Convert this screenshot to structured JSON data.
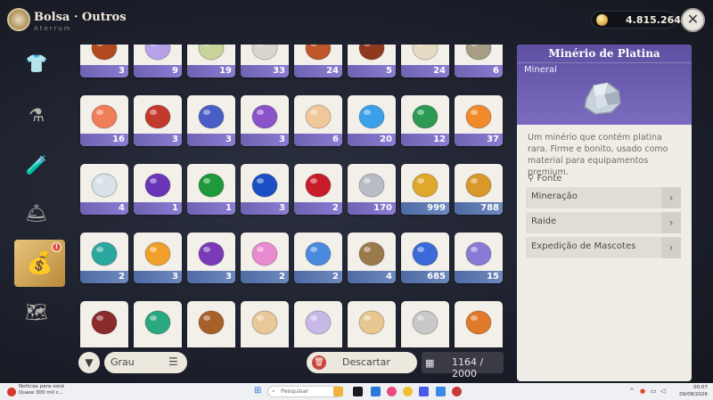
{
  "header": {
    "title": "Bolsa · Outros",
    "subtitle": "Aterrum",
    "currency_value": "4.815.264",
    "close_label": "✕"
  },
  "sidebar": {
    "items": [
      {
        "name": "sidebar-item-clothing",
        "icon": "shirt-icon",
        "glyph": "👕"
      },
      {
        "name": "sidebar-item-crafting",
        "icon": "flask-icon",
        "glyph": "⚗"
      },
      {
        "name": "sidebar-item-potion",
        "icon": "potion-icon",
        "glyph": "🧪"
      },
      {
        "name": "sidebar-item-food",
        "icon": "cloche-icon",
        "glyph": "🛎"
      },
      {
        "name": "sidebar-item-others",
        "icon": "bag-icon",
        "glyph": "💰",
        "badge": "!"
      },
      {
        "name": "sidebar-item-map",
        "icon": "map-icon",
        "glyph": "🗺"
      }
    ]
  },
  "inventory": {
    "rows": [
      [
        {
          "name": "beetle",
          "qty": "3",
          "color": "#b34a1f"
        },
        {
          "name": "pearl",
          "qty": "9",
          "color": "#b7a1e8"
        },
        {
          "name": "leaf",
          "qty": "19",
          "color": "#c8d49a"
        },
        {
          "name": "feather",
          "qty": "33",
          "color": "#d9d5cf"
        },
        {
          "name": "fur-ball",
          "qty": "24",
          "color": "#c0572a"
        },
        {
          "name": "spiky-fruit",
          "qty": "5",
          "color": "#8f3a1e"
        },
        {
          "name": "bone-hook",
          "qty": "24",
          "color": "#e6dcc4"
        },
        {
          "name": "fish-skeleton",
          "qty": "6",
          "color": "#a79c84"
        }
      ],
      [
        {
          "name": "orange-flower",
          "qty": "16",
          "color": "#f07e5a"
        },
        {
          "name": "red-spike-plant",
          "qty": "3",
          "color": "#c13a2c"
        },
        {
          "name": "blue-bellflower",
          "qty": "3",
          "color": "#4a5ec8"
        },
        {
          "name": "purple-flower",
          "qty": "3",
          "color": "#8a53c9"
        },
        {
          "name": "larva",
          "qty": "6",
          "color": "#f0c89a"
        },
        {
          "name": "blue-butterfly",
          "qty": "20",
          "color": "#3aa0e8"
        },
        {
          "name": "green-egg",
          "qty": "12",
          "color": "#2c9a54"
        },
        {
          "name": "orange-egg",
          "qty": "37",
          "color": "#f08a2a"
        }
      ],
      [
        {
          "name": "opal-stone",
          "qty": "4",
          "color": "#d9e2e8"
        },
        {
          "name": "amethyst",
          "qty": "1",
          "color": "#6b35b8"
        },
        {
          "name": "emerald",
          "qty": "1",
          "color": "#1f9a3a"
        },
        {
          "name": "sapphire",
          "qty": "3",
          "color": "#1c4fc4"
        },
        {
          "name": "ruby",
          "qty": "2",
          "color": "#c81c2a"
        },
        {
          "name": "silver-ingot",
          "qty": "170",
          "color": "#b8bcc4"
        },
        {
          "name": "gold-nugget",
          "qty": "999",
          "color": "#e0a82a",
          "blue": true
        },
        {
          "name": "gold-ore",
          "qty": "788",
          "color": "#d9982a",
          "blue": true
        }
      ],
      [
        {
          "name": "teal-lure",
          "qty": "2",
          "color": "#2aa8a0",
          "blue": true
        },
        {
          "name": "orange-lure",
          "qty": "3",
          "color": "#f0a02a",
          "blue": true
        },
        {
          "name": "purple-lure",
          "qty": "3",
          "color": "#7a3ab8",
          "blue": true
        },
        {
          "name": "rainbow-lure",
          "qty": "2",
          "color": "#e88ad0",
          "blue": true
        },
        {
          "name": "blue-lure",
          "qty": "2",
          "color": "#4a8ae0",
          "blue": true
        },
        {
          "name": "fish-bait",
          "qty": "4",
          "color": "#9a7a4a",
          "blue": true
        },
        {
          "name": "blue-gem-charm",
          "qty": "685",
          "color": "#3a6ad8",
          "blue": true
        },
        {
          "name": "crystal-charm",
          "qty": "15",
          "color": "#8a7ad8",
          "blue": true
        }
      ],
      [
        {
          "name": "red-pot",
          "qty": "",
          "color": "#8a2a2a"
        },
        {
          "name": "green-fish",
          "qty": "",
          "color": "#2aa880"
        },
        {
          "name": "clay-plate",
          "qty": "",
          "color": "#a8602a"
        },
        {
          "name": "cracker",
          "qty": "",
          "color": "#e8c898"
        },
        {
          "name": "rainbow-sand",
          "qty": "",
          "color": "#c8b8e8"
        },
        {
          "name": "sand-pile",
          "qty": "",
          "color": "#e8c890"
        },
        {
          "name": "yarn-ball",
          "qty": "",
          "color": "#c8c8c8"
        },
        {
          "name": "orange-fluff",
          "qty": "",
          "color": "#e07a2a"
        }
      ]
    ]
  },
  "bottom_bar": {
    "sort_label": "Grau",
    "discard_label": "Descartar",
    "capacity": "1164 / 2000"
  },
  "detail": {
    "title": "Minério de Platina",
    "category": "Mineral",
    "description": "Um minério que contém platina rara. Firme e bonito, usado como material para equipamentos premium.",
    "source_header": "Fonte",
    "sources": [
      "Mineração",
      "Raide",
      "Expedição de Mascotes"
    ]
  },
  "taskbar": {
    "news_line1": "Notícias para você",
    "news_line2": "Quase 300 mil c...",
    "search_placeholder": "Pesquisar",
    "time": "00:07",
    "date": "09/08/2026"
  },
  "colors": {
    "accent_purple": "#7b6cc0",
    "qty_purple": "#8b7cd2",
    "qty_blue": "#6f89bf",
    "panel_bg": "#f0ede7"
  }
}
